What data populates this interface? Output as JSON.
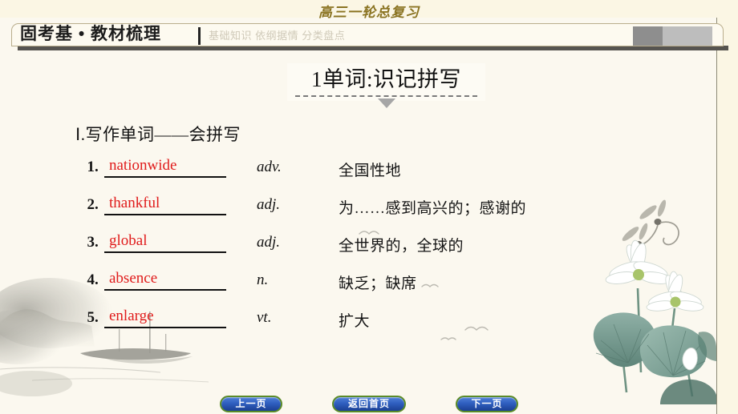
{
  "top_title": "高三一轮总复习",
  "header": {
    "main_label": "固考基 • 教材梳理",
    "sub_label": "基础知识  依纲据情  分类盘点"
  },
  "banner": {
    "text": "1单词:识记拼写"
  },
  "section": {
    "heading": "Ⅰ.写作单词——会拼写"
  },
  "words": [
    {
      "num": "1",
      "dot": ".",
      "word": "nationwide",
      "pos": "adv.",
      "definition": "全国性地"
    },
    {
      "num": "2",
      "dot": ".",
      "word": "thankful",
      "pos": "adj.",
      "definition": "为……感到高兴的；感谢的"
    },
    {
      "num": "3",
      "dot": ".",
      "word": "global",
      "pos": "adj.",
      "definition": "全世界的，全球的"
    },
    {
      "num": "4",
      "dot": ".",
      "word": "absence",
      "pos": "n.",
      "definition": "缺乏；缺席"
    },
    {
      "num": "5",
      "dot": ".",
      "word": "enlarge",
      "pos": "vt.",
      "definition": "扩大"
    }
  ],
  "footer": {
    "prev_label": "上一页",
    "home_label": "返回首页",
    "next_label": "下一页"
  },
  "colors": {
    "page_background": "#fbf6e4",
    "content_background": "#fbf8ef",
    "title_accent": "#8a7320",
    "word_accent": "#e01b1b",
    "nav_button_fill": "#2f5fc0",
    "nav_button_border": "#5b8b28"
  },
  "decorations": {
    "lotus": "lotus-flowers-illustration",
    "ink_landscape": "ink-wash-boat-landscape",
    "dragonflies": "dragonfly-pair",
    "birds": "flying-birds"
  }
}
